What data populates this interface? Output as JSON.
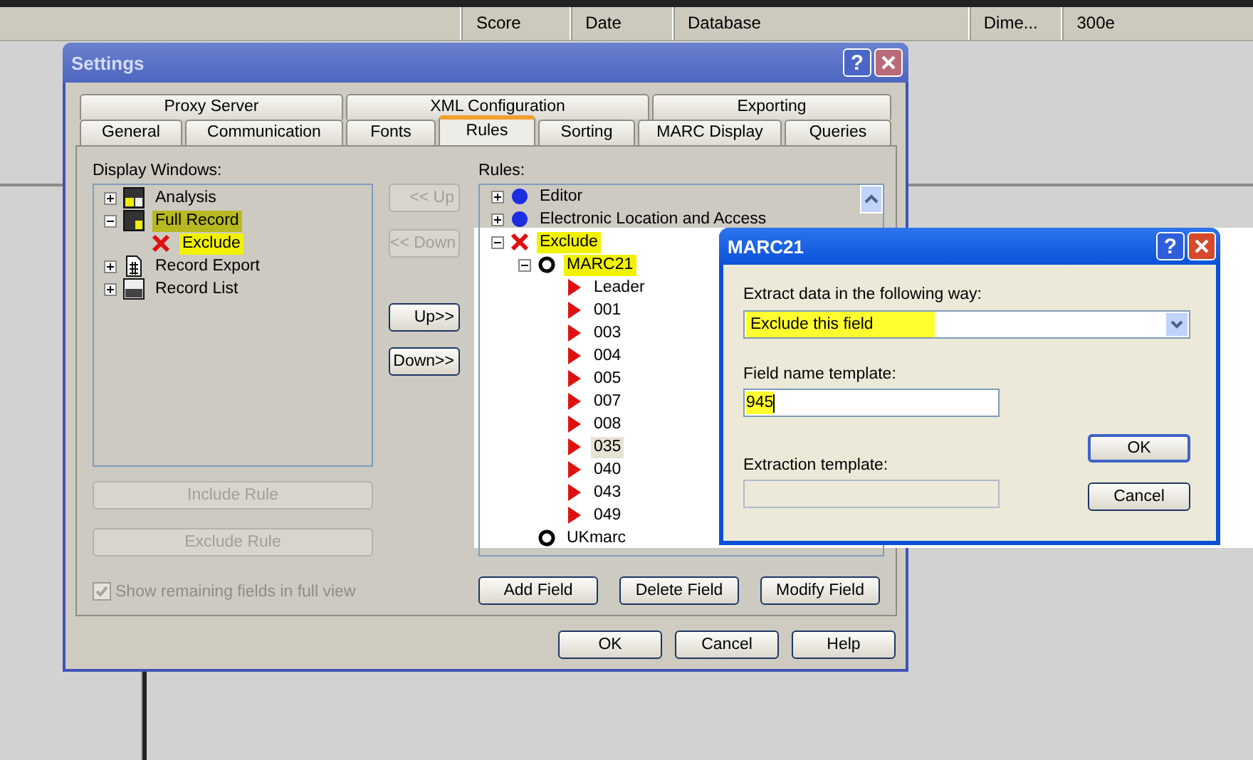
{
  "header": {
    "columns": [
      "Score",
      "Date",
      "Database",
      "Dime...",
      "300e"
    ]
  },
  "settings": {
    "title": "Settings",
    "help_button": "?",
    "tab_rows": [
      [
        {
          "label": "Proxy Server",
          "selected": false
        },
        {
          "label": "XML Configuration",
          "selected": false
        },
        {
          "label": "Exporting",
          "selected": false
        }
      ],
      [
        {
          "label": "General",
          "selected": false
        },
        {
          "label": "Communication",
          "selected": false
        },
        {
          "label": "Fonts",
          "selected": false
        },
        {
          "label": "Rules",
          "selected": true
        },
        {
          "label": "Sorting",
          "selected": false
        },
        {
          "label": "MARC Display",
          "selected": false
        },
        {
          "label": "Queries",
          "selected": false
        }
      ]
    ],
    "display_windows": {
      "label": "Display Windows:",
      "tree": [
        {
          "label": "Analysis",
          "kind": "window",
          "expanded": false,
          "selected": false,
          "highlighted": false
        },
        {
          "label": "Full Record",
          "kind": "window",
          "expanded": true,
          "selected": true,
          "highlighted": true,
          "children": [
            {
              "label": "Exclude",
              "kind": "rule",
              "selected": false,
              "highlighted": true
            }
          ]
        },
        {
          "label": "Record Export",
          "kind": "window",
          "expanded": false,
          "selected": false,
          "highlighted": false
        },
        {
          "label": "Record List",
          "kind": "window",
          "expanded": false,
          "selected": false,
          "highlighted": false
        }
      ]
    },
    "move_buttons": [
      {
        "label": "<< Up",
        "disabled": true
      },
      {
        "label": "<< Down",
        "disabled": true
      },
      {
        "label": "Up>>",
        "disabled": false
      },
      {
        "label": "Down>>",
        "disabled": false
      }
    ],
    "rule_buttons": [
      {
        "label": "Include Rule",
        "disabled": true
      },
      {
        "label": "Exclude Rule",
        "disabled": true
      }
    ],
    "show_remaining": {
      "label": "Show remaining fields in full view",
      "checked": true,
      "disabled": true
    },
    "rules": {
      "label": "Rules:",
      "tree": [
        {
          "label": "Editor",
          "kind": "group",
          "expanded": false,
          "selected": false,
          "highlighted": false
        },
        {
          "label": "Electronic Location and Access",
          "kind": "group",
          "expanded": false,
          "selected": false,
          "highlighted": false
        },
        {
          "label": "Exclude",
          "kind": "rule",
          "expanded": true,
          "selected": false,
          "highlighted": true,
          "children": [
            {
              "label": "MARC21",
              "kind": "format",
              "expanded": true,
              "selected": false,
              "highlighted": true,
              "children": [
                {
                  "label": "Leader",
                  "kind": "field",
                  "selected": false,
                  "highlighted": false
                },
                {
                  "label": "001",
                  "kind": "field",
                  "selected": false,
                  "highlighted": false
                },
                {
                  "label": "003",
                  "kind": "field",
                  "selected": false,
                  "highlighted": false
                },
                {
                  "label": "004",
                  "kind": "field",
                  "selected": false,
                  "highlighted": false
                },
                {
                  "label": "005",
                  "kind": "field",
                  "selected": false,
                  "highlighted": false
                },
                {
                  "label": "007",
                  "kind": "field",
                  "selected": false,
                  "highlighted": false
                },
                {
                  "label": "008",
                  "kind": "field",
                  "selected": false,
                  "highlighted": false
                },
                {
                  "label": "035",
                  "kind": "field",
                  "selected": true,
                  "highlighted": false
                },
                {
                  "label": "040",
                  "kind": "field",
                  "selected": false,
                  "highlighted": false
                },
                {
                  "label": "043",
                  "kind": "field",
                  "selected": false,
                  "highlighted": false
                },
                {
                  "label": "049",
                  "kind": "field",
                  "selected": false,
                  "highlighted": false
                }
              ]
            },
            {
              "label": "UKmarc",
              "kind": "format",
              "selected": false,
              "highlighted": false
            }
          ]
        }
      ]
    },
    "field_buttons": [
      "Add Field",
      "Delete Field",
      "Modify Field"
    ],
    "buttons": [
      "OK",
      "Cancel",
      "Help"
    ]
  },
  "marc21": {
    "title": "MARC21",
    "help_button": "?",
    "extract": {
      "label": "Extract data in the following way:",
      "value": "Exclude this field",
      "highlighted": true
    },
    "field_name": {
      "label": "Field name template:",
      "value": "945",
      "highlighted": true
    },
    "extraction": {
      "label": "Extraction template:",
      "disabled": true
    },
    "buttons": [
      "OK",
      "Cancel"
    ]
  }
}
